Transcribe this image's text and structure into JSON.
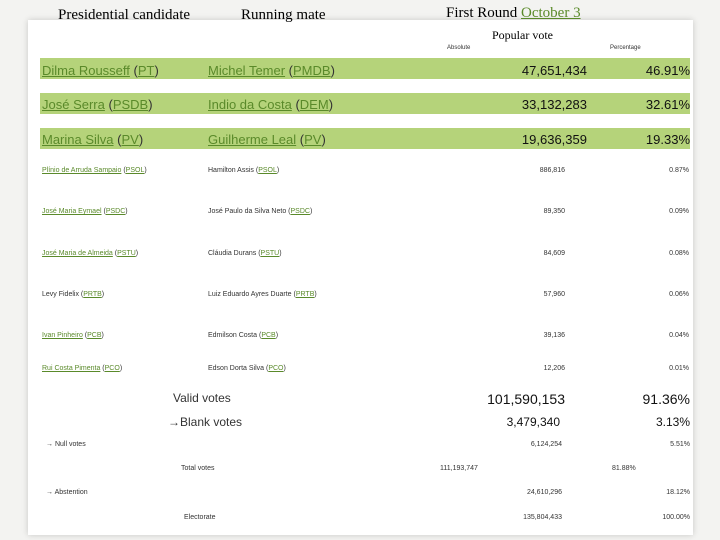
{
  "header": {
    "candidate_col": "Presidential candidate",
    "runningmate_col": "Running mate",
    "round": "First Round",
    "round_date": "October 3",
    "popular_vote": "Popular vote",
    "absolute": "Absolute",
    "percentage": "Percentage"
  },
  "major": [
    {
      "candidate": "Dilma Rousseff",
      "c_party": "PT",
      "mate": "Michel Temer",
      "m_party": "PMDB",
      "votes": "47,651,434",
      "pct": "46.91%"
    },
    {
      "candidate": "José Serra",
      "c_party": "PSDB",
      "mate": "Indio da Costa",
      "m_party": "DEM",
      "votes": "33,132,283",
      "pct": "32.61%"
    },
    {
      "candidate": "Marina Silva",
      "c_party": "PV",
      "mate": "Guilherme Leal",
      "m_party": "PV",
      "votes": "19,636,359",
      "pct": "19.33%"
    }
  ],
  "minor": [
    {
      "candidate": "Plínio de Arruda Sampaio",
      "c_party": "PSOL",
      "mate": "Hamilton Assis",
      "m_party": "PSOL",
      "votes": "886,816",
      "pct": "0.87%"
    },
    {
      "candidate": "José Maria Eymael",
      "c_party": "PSDC",
      "mate": "José Paulo da Silva Neto",
      "m_party": "PSDC",
      "votes": "89,350",
      "pct": "0.09%"
    },
    {
      "candidate": "José Maria de Almeida",
      "c_party": "PSTU",
      "mate": "Cláudia Durans",
      "m_party": "PSTU",
      "votes": "84,609",
      "pct": "0.08%"
    },
    {
      "candidate": "Levy Fidelix",
      "c_party": "PRTB",
      "mate": "Luiz Eduardo Ayres Duarte",
      "m_party": "PRTB",
      "votes": "57,960",
      "pct": "0.06%"
    },
    {
      "candidate": "Ivan Pinheiro",
      "c_party": "PCB",
      "mate": "Edmilson Costa",
      "m_party": "PCB",
      "votes": "39,136",
      "pct": "0.04%"
    },
    {
      "candidate": "Rui Costa Pimenta",
      "c_party": "PCO",
      "mate": "Edson Dorta Silva",
      "m_party": "PCO",
      "votes": "12,206",
      "pct": "0.01%"
    }
  ],
  "totals": {
    "valid_label": "Valid votes",
    "valid_votes": "101,590,153",
    "valid_pct": "91.36%",
    "blank_label": "Blank votes",
    "blank_votes": "3,479,340",
    "blank_pct": "3.13%",
    "null_label": "Null votes",
    "null_votes": "6,124,254",
    "null_pct": "5.51%",
    "total_label": "Total votes",
    "total_votes": "111,193,747",
    "total_pct": "81.88%",
    "abst_label": "Abstention",
    "abst_votes": "24,610,296",
    "abst_pct": "18.12%",
    "electorate_label": "Electorate",
    "electorate_votes": "135,804,433",
    "electorate_pct": "100.00%"
  },
  "colors": {
    "band": "#b5d37a",
    "link": "#5a8a2a"
  },
  "icons": {
    "arrow": "arrow-right-icon"
  }
}
